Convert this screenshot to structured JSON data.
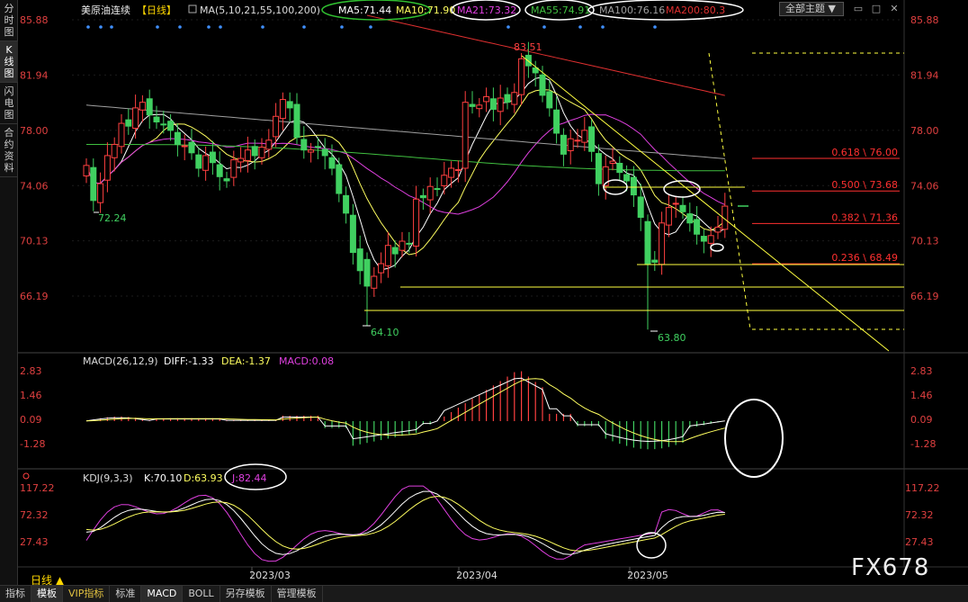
{
  "left_tabs": [
    "分\n时\n图",
    "K\n线\n图",
    "闪\n电\n图",
    "合\n约\n资\n料"
  ],
  "left_tab_active": 1,
  "header": {
    "title": "美原油连续",
    "period": "【日线】",
    "ma_label": "MA(5,10,21,55,100,200)",
    "ma5": "MA5:71.44",
    "ma10": "MA10:71.90",
    "ma21": "MA21:73.32",
    "ma55": "MA55:74.91",
    "ma100": "MA100:76.16",
    "ma200": "MA200:80.3",
    "theme": "全部主题 ▼"
  },
  "colors": {
    "up": "#ff4040",
    "down": "#40d060",
    "ma5": "#ffffff",
    "ma10": "#ffff60",
    "ma21": "#e040e0",
    "ma55": "#40c040",
    "ma100": "#a0a0a0",
    "ma200": "#e03030",
    "fib": "#ff3030"
  },
  "price_axis": {
    "ticks": [
      "85.88",
      "81.94",
      "78.00",
      "74.06",
      "70.13",
      "66.19"
    ]
  },
  "price_labels": {
    "high": "83.51",
    "low1": "64.10",
    "low2": "63.80",
    "left_low": "72.24"
  },
  "fib_levels": [
    {
      "label": "0.618 \\ 76.00",
      "value": 76.0
    },
    {
      "label": "0.500 \\ 73.68",
      "value": 73.68
    },
    {
      "label": "0.382 \\ 71.36",
      "value": 71.36
    },
    {
      "label": "0.236 \\ 68.49",
      "value": 68.49
    }
  ],
  "macd": {
    "header": "MACD(26,12,9)",
    "diff": "DIFF:-1.33",
    "dea": "DEA:-1.37",
    "macd": "MACD:0.08",
    "ticks": [
      "2.83",
      "1.46",
      "0.09",
      "-1.28"
    ]
  },
  "kdj": {
    "header": "KDJ(9,3,3)",
    "k": "K:70.10",
    "d": "D:63.93",
    "j": "J:82.44",
    "ticks": [
      "117.22",
      "72.32",
      "27.43"
    ]
  },
  "date_labels": [
    "2023/03",
    "2023/04",
    "2023/05"
  ],
  "period_label": "日线 ▲",
  "bottom_tabs": [
    "指标",
    "模板",
    "VIP指标",
    "标准",
    "MACD",
    "BOLL",
    "另存模板",
    "管理模板"
  ],
  "logo": "FX678"
}
